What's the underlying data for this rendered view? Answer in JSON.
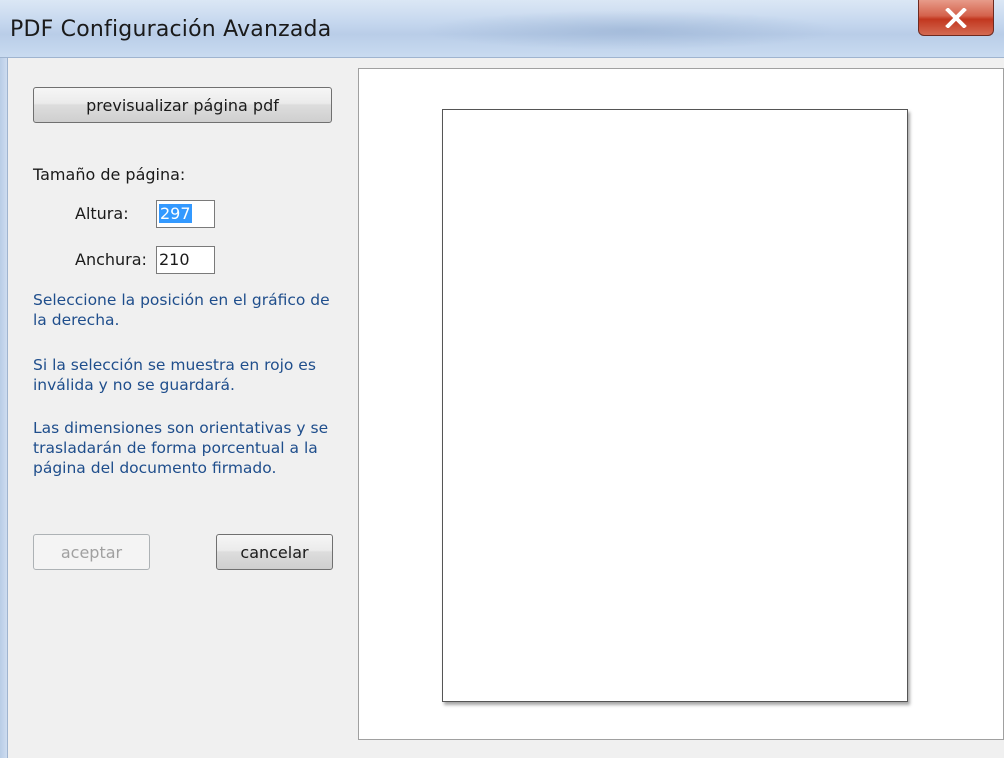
{
  "window": {
    "title": "PDF Configuración Avanzada",
    "close_glyph": "X"
  },
  "form": {
    "preview_button": "previsualizar página pdf",
    "page_size_label": "Tamaño de página:",
    "height_label": "Altura:",
    "height_value": "297",
    "width_label": "Anchura:",
    "width_value": "210",
    "info_select_position": "Seleccione la posición en el gráfico de la derecha.",
    "info_red_invalid": "Si la selección se muestra en rojo es inválida y no se guardará.",
    "info_dimensions": "Las dimensiones son orientativas y se trasladarán de forma porcentual a la página del documento firmado.",
    "accept_button": "aceptar",
    "accept_enabled": false,
    "cancel_button": "cancelar"
  },
  "icons": {
    "close": "close-icon"
  },
  "colors": {
    "info_text": "#1f4e8c",
    "close_button": "#c2371f",
    "selection": "#3399ff"
  }
}
